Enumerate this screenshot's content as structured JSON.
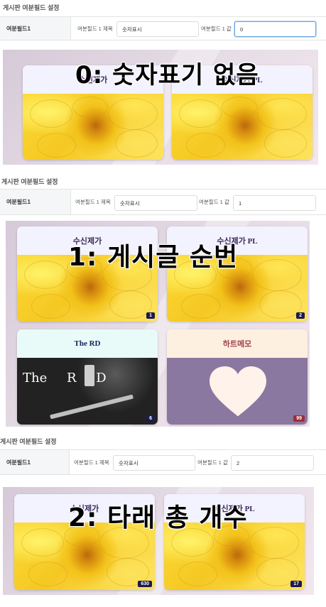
{
  "sections": [
    {
      "title": "게시판 여분필드 설정",
      "row_label": "여분필드1",
      "field_title_label": "여분필드 1 제목",
      "field_title_value": "숫자표시",
      "field_value_label": "여분필드 1 값",
      "field_value_value": "0",
      "overlay": "0: 숫자표기 없음",
      "cards": [
        {
          "title": "수신제가",
          "badge": ""
        },
        {
          "title": "수신제가 PL",
          "badge": ""
        }
      ]
    },
    {
      "title": "게시판 여분필드 설정",
      "row_label": "여분필드1",
      "field_title_label": "여분필드 1 제목",
      "field_title_value": "숫자표시",
      "field_value_label": "여분필드 1 값",
      "field_value_value": "1",
      "overlay": "1: 게시글 순번",
      "cards": [
        {
          "title": "수신제가",
          "badge": "1"
        },
        {
          "title": "수신제가 PL",
          "badge": "2"
        },
        {
          "title": "The RD",
          "badge": "6",
          "image_text": "The R D"
        },
        {
          "title": "하트메모",
          "badge": "99"
        }
      ]
    },
    {
      "title": "게시판 여분필드 설정",
      "row_label": "여분필드1",
      "field_title_label": "여분필드 1 제목",
      "field_title_value": "숫자표시",
      "field_value_label": "여분필드 1 값",
      "field_value_value": "2",
      "overlay": "2: 타래 총 개수",
      "cards": [
        {
          "title": "수신제가",
          "badge": "630"
        },
        {
          "title": "수신제가 PL",
          "badge": "17"
        }
      ]
    }
  ],
  "colors": {
    "badge_dark": "#1c1a4f",
    "badge_red": "#9a2d3d",
    "focus_border": "#6ea7e0",
    "panel_lavender": "#d6c9d8"
  }
}
